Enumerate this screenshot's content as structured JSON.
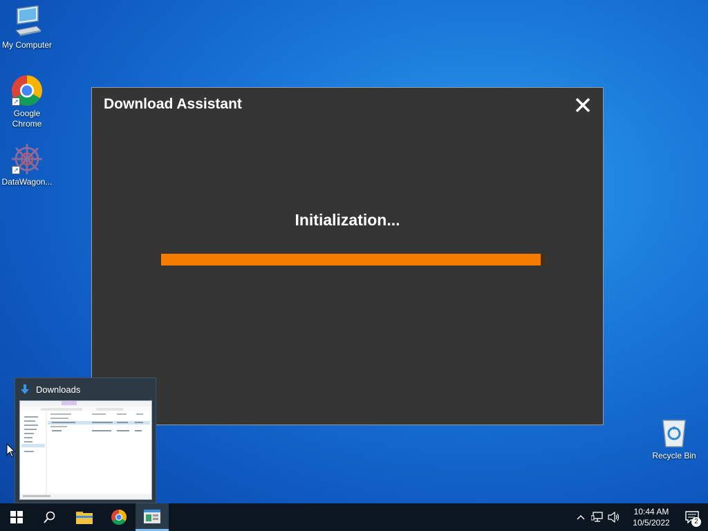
{
  "desktop": {
    "icons": [
      {
        "label": "My Computer"
      },
      {
        "label": "Google Chrome"
      },
      {
        "label": "DataWagon..."
      }
    ],
    "recycle_bin": {
      "label": "Recycle Bin"
    }
  },
  "dialog": {
    "title": "Download Assistant",
    "status": "Initialization...",
    "progress_percent": 99,
    "accent_color": "#f57c00",
    "background_color": "#353535"
  },
  "thumbnail": {
    "title": "Downloads"
  },
  "taskbar": {
    "items": [
      "start-icon",
      "search-icon",
      "file-explorer-icon",
      "chrome-icon",
      "app-window-icon"
    ],
    "clock": {
      "time": "10:44 AM",
      "date": "10/5/2022"
    },
    "notification_count": "2"
  }
}
